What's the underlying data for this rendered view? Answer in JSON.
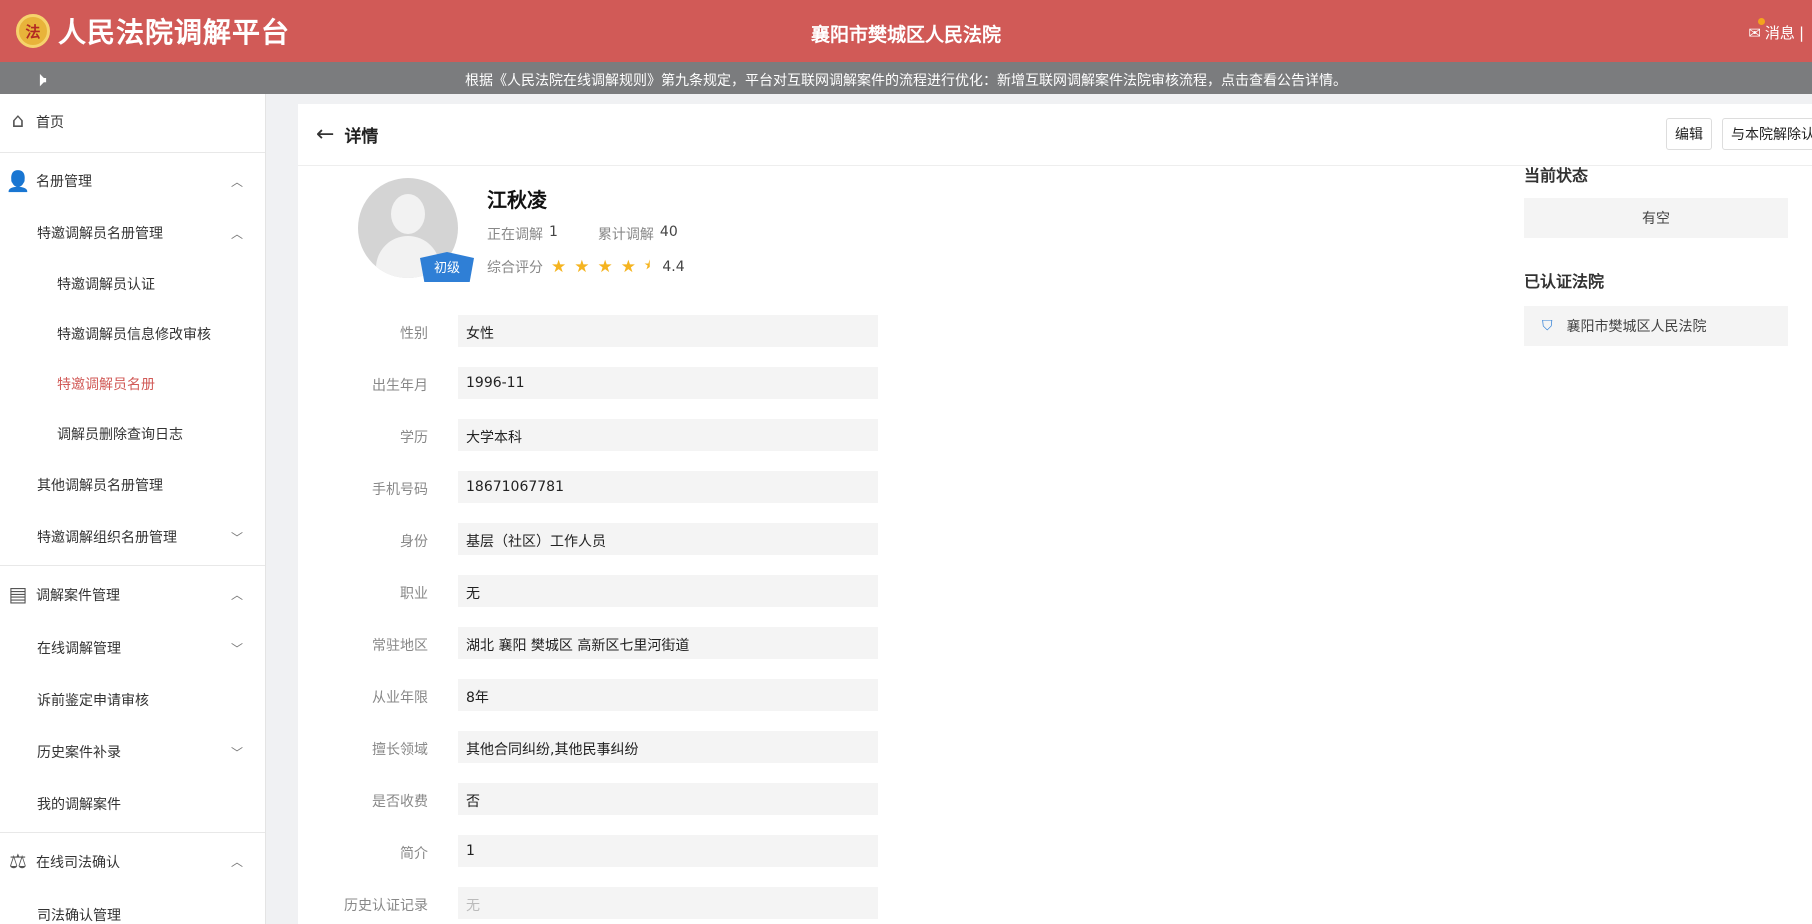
{
  "header": {
    "logo_glyph": "法",
    "app_title": "人民法院调解平台",
    "court_name": "襄阳市樊城区人民法院",
    "messages_label": "消息",
    "separator": "|"
  },
  "notice": {
    "text": "根据《人民法院在线调解规则》第九条规定，平台对互联网调解案件的流程进行优化：新增互联网调解案件法院审核流程，点击查看公告详情。"
  },
  "sidebar": {
    "home": "首页",
    "roster": "名册管理",
    "invited_roster": "特邀调解员名册管理",
    "invited_cert": "特邀调解员认证",
    "invited_edit_review": "特邀调解员信息修改审核",
    "invited_list": "特邀调解员名册",
    "delete_log": "调解员删除查询日志",
    "other_roster": "其他调解员名册管理",
    "org_roster": "特邀调解组织名册管理",
    "case_mgmt": "调解案件管理",
    "online_mediation": "在线调解管理",
    "pre_suit": "诉前鉴定申请审核",
    "history_cases": "历史案件补录",
    "my_cases": "我的调解案件",
    "judicial_confirm": "在线司法确认",
    "judicial_mgmt": "司法确认管理"
  },
  "detail": {
    "title": "详情",
    "edit_button": "编辑",
    "unbind_button": "与本院解除认",
    "badge": "初级",
    "name": "江秋凌",
    "ongoing_label": "正在调解",
    "ongoing_value": "1",
    "total_label": "累计调解",
    "total_value": "40",
    "rating_label": "综合评分",
    "rating_value": "4.4",
    "rating_stars": 4.4,
    "fields": [
      {
        "label": "性别",
        "value": "女性"
      },
      {
        "label": "出生年月",
        "value": "1996-11"
      },
      {
        "label": "学历",
        "value": "大学本科"
      },
      {
        "label": "手机号码",
        "value": "18671067781"
      },
      {
        "label": "身份",
        "value": "基层（社区）工作人员"
      },
      {
        "label": "职业",
        "value": "无"
      },
      {
        "label": "常驻地区",
        "value": "湖北 襄阳 樊城区 高新区七里河街道"
      },
      {
        "label": "从业年限",
        "value": "8年"
      },
      {
        "label": "擅长领域",
        "value": "其他合同纠纷,其他民事纠纷"
      },
      {
        "label": "是否收费",
        "value": "否"
      },
      {
        "label": "简介",
        "value": "1"
      },
      {
        "label": "历史认证记录",
        "value": "无"
      }
    ],
    "status_title": "当前状态",
    "status_value": "有空",
    "courts_title": "已认证法院",
    "court_value": "襄阳市樊城区人民法院"
  },
  "colors": {
    "brand": "#d15a57",
    "notice_bg": "#7b7c7e",
    "star": "#f5b420",
    "badge": "#2f7fd6"
  }
}
